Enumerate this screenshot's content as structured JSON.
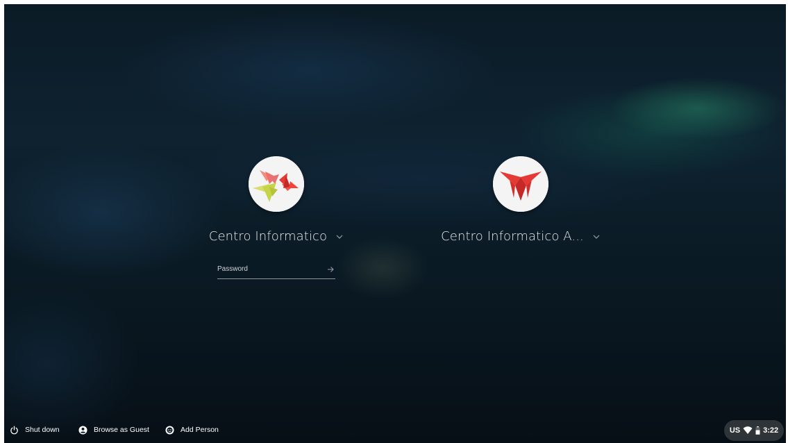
{
  "users": [
    {
      "name": "Centro Informatico",
      "avatar": "origami-birds-avatar",
      "password_placeholder": "Password",
      "password_value": ""
    },
    {
      "name": "Centro Informatico A...",
      "avatar": "origami-butterfly-avatar"
    }
  ],
  "shelf": {
    "shutdown_label": "Shut down",
    "guest_label": "Browse as Guest",
    "add_person_label": "Add Person"
  },
  "status": {
    "keyboard_layout": "US",
    "time": "3:22"
  },
  "colors": {
    "text": "#e8eaed",
    "avatar_red": "#e53935",
    "avatar_yellow": "#c6d44a"
  }
}
